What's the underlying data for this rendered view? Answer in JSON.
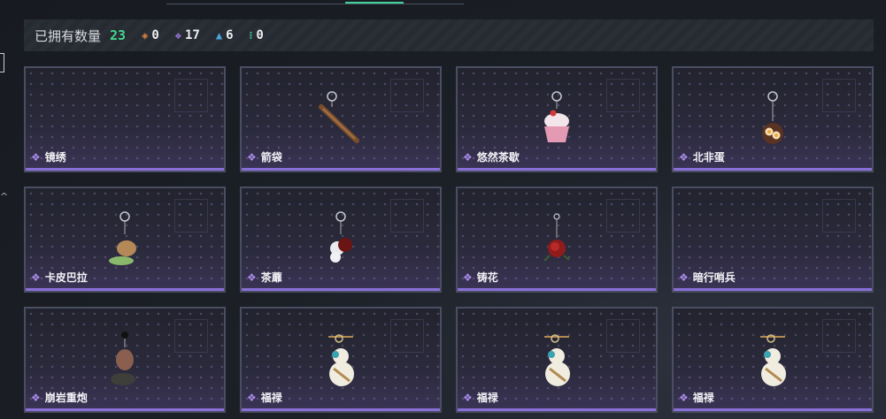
{
  "stats": {
    "owned_label": "已拥有数量",
    "owned_total": "23",
    "items": [
      {
        "icon": "orange-diamond-icon",
        "symbol": "◈",
        "color": "#d8813f",
        "value": "0"
      },
      {
        "icon": "purple-diamond-icon",
        "symbol": "❖",
        "color": "#9c7ae6",
        "value": "17"
      },
      {
        "icon": "blue-triangle-icon",
        "symbol": "▲",
        "color": "#4aa6e0",
        "value": "6"
      },
      {
        "icon": "green-dots-icon",
        "symbol": "⁝",
        "color": "#3fd29a",
        "value": "0"
      }
    ]
  },
  "colors": {
    "accent": "#3fd29a",
    "rarity": "#8a6fd8"
  },
  "cards": [
    {
      "name": "镜绣"
    },
    {
      "name": "箭袋"
    },
    {
      "name": "悠然茶歇"
    },
    {
      "name": "北非蛋"
    },
    {
      "name": "卡皮巴拉"
    },
    {
      "name": "茶蘼"
    },
    {
      "name": "铸花"
    },
    {
      "name": "暗行哨兵"
    },
    {
      "name": "崩岩重炮"
    },
    {
      "name": "福禄"
    },
    {
      "name": "福禄"
    },
    {
      "name": "福禄"
    }
  ]
}
